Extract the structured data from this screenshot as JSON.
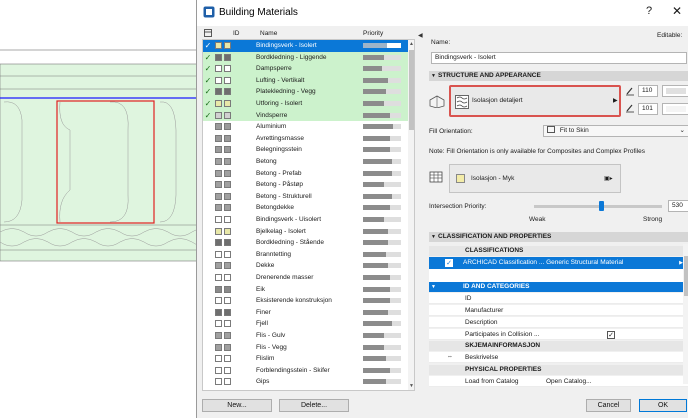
{
  "window": {
    "title": "Building Materials"
  },
  "list": {
    "headers": {
      "id": "ID",
      "name": "Name",
      "priority": "Priority"
    },
    "rows": [
      {
        "name": "Bindingsverk - Isolert",
        "checked": true,
        "state": "sel",
        "color": "#e8e8a8",
        "priority": 0.62
      },
      {
        "name": "Bordkledning - Liggende",
        "checked": true,
        "state": "hl",
        "color": "#6e6e6e",
        "priority": 0.55
      },
      {
        "name": "Dampsperre",
        "checked": true,
        "state": "hl",
        "color": "#ffffff",
        "priority": 0.5
      },
      {
        "name": "Lufting - Vertikalt",
        "checked": true,
        "state": "hl",
        "color": "#ffffff",
        "priority": 0.66
      },
      {
        "name": "Platekledning - Vegg",
        "checked": true,
        "state": "hl",
        "color": "#6e6e6e",
        "priority": 0.6
      },
      {
        "name": "Utforing - Isolert",
        "checked": true,
        "state": "hl",
        "color": "#e8e8a8",
        "priority": 0.55
      },
      {
        "name": "Vindsperre",
        "checked": true,
        "state": "hl",
        "color": "#d0d0d0",
        "priority": 0.7
      },
      {
        "name": "Aluminium",
        "checked": false,
        "state": "",
        "color": "#9a9a9a",
        "priority": 0.8
      },
      {
        "name": "Avrettingsmasse",
        "checked": false,
        "state": "",
        "color": "#9a9a9a",
        "priority": 0.7
      },
      {
        "name": "Belegningsstein",
        "checked": false,
        "state": "",
        "color": "#9a9a9a",
        "priority": 0.7
      },
      {
        "name": "Betong",
        "checked": false,
        "state": "",
        "color": "#a0a0a0",
        "priority": 0.75
      },
      {
        "name": "Betong - Prefab",
        "checked": false,
        "state": "",
        "color": "#a0a0a0",
        "priority": 0.75
      },
      {
        "name": "Betong - Påstøp",
        "checked": false,
        "state": "",
        "color": "#a0a0a0",
        "priority": 0.55
      },
      {
        "name": "Betong - Strukturell",
        "checked": false,
        "state": "",
        "color": "#a0a0a0",
        "priority": 0.75
      },
      {
        "name": "Betongdekke",
        "checked": false,
        "state": "",
        "color": "#a0a0a0",
        "priority": 0.7
      },
      {
        "name": "Bindingsverk - Uisolert",
        "checked": false,
        "state": "",
        "color": "#ffffff",
        "priority": 0.55
      },
      {
        "name": "Bjelkelag - Isolert",
        "checked": false,
        "state": "",
        "color": "#e8e8a8",
        "priority": 0.65
      },
      {
        "name": "Bordkledning - Stående",
        "checked": false,
        "state": "",
        "color": "#6e6e6e",
        "priority": 0.65
      },
      {
        "name": "Branntetting",
        "checked": false,
        "state": "",
        "color": "#ffffff",
        "priority": 0.6
      },
      {
        "name": "Dekke",
        "checked": false,
        "state": "",
        "color": "#a0a0a0",
        "priority": 0.65
      },
      {
        "name": "Drenerende masser",
        "checked": false,
        "state": "",
        "color": "#ffffff",
        "priority": 0.7
      },
      {
        "name": "Eik",
        "checked": false,
        "state": "",
        "color": "#8a8a8a",
        "priority": 0.7
      },
      {
        "name": "Eksisterende konstruksjon",
        "checked": false,
        "state": "",
        "color": "#ffffff",
        "priority": 0.7
      },
      {
        "name": "Finer",
        "checked": false,
        "state": "",
        "color": "#6e6e6e",
        "priority": 0.65
      },
      {
        "name": "Fjell",
        "checked": false,
        "state": "",
        "color": "#ffffff",
        "priority": 0.75
      },
      {
        "name": "Flis - Gulv",
        "checked": false,
        "state": "",
        "color": "#a0a0a0",
        "priority": 0.55
      },
      {
        "name": "Flis - Vegg",
        "checked": false,
        "state": "",
        "color": "#a0a0a0",
        "priority": 0.55
      },
      {
        "name": "Flislim",
        "checked": false,
        "state": "",
        "color": "#ffffff",
        "priority": 0.6
      },
      {
        "name": "Forblendingsstein - Skifer",
        "checked": false,
        "state": "",
        "color": "#ffffff",
        "priority": 0.7
      },
      {
        "name": "Gips",
        "checked": false,
        "state": "",
        "color": "#ffffff",
        "priority": 0.6
      }
    ],
    "new_button": "New...",
    "delete_button": "Delete..."
  },
  "details": {
    "name_label": "Name:",
    "editable_label": "Editable:",
    "name_value": "Bindingsverk - Isolert",
    "structure_section": "STRUCTURE AND APPEARANCE",
    "fill_name": "Isolasjon detaljert",
    "pen1": "110",
    "pen2": "101",
    "fill_orientation_label": "Fill Orientation:",
    "fill_orientation_value": "Fit to Skin",
    "note": "Note: Fill Orientation is only available for Composites and Complex Profiles",
    "surface_name": "Isolasjon - Myk",
    "intersection_label": "Intersection Priority:",
    "intersection_value": "530",
    "intersection_level": 0.53,
    "weak_label": "Weak",
    "strong_label": "Strong",
    "classification_section": "CLASSIFICATION AND PROPERTIES",
    "classifications_header": "CLASSIFICATIONS",
    "classification_value": "ARCHICAD Classification ... Generic Structural Material",
    "id_categories": "ID AND CATEGORIES",
    "props": [
      {
        "key": "ID",
        "value": ""
      },
      {
        "key": "Manufacturer",
        "value": ""
      },
      {
        "key": "Description",
        "value": ""
      },
      {
        "key": "Participates in Collision ...",
        "value": ""
      }
    ],
    "skjema_header": "SKJEMAINFORMASJON",
    "beskrivelse": "Beskrivelse",
    "physical_header": "PHYSICAL PROPERTIES",
    "load_catalog_label": "Load from Catalog",
    "open_catalog": "Open Catalog...",
    "cancel_button": "Cancel",
    "ok_button": "OK"
  }
}
